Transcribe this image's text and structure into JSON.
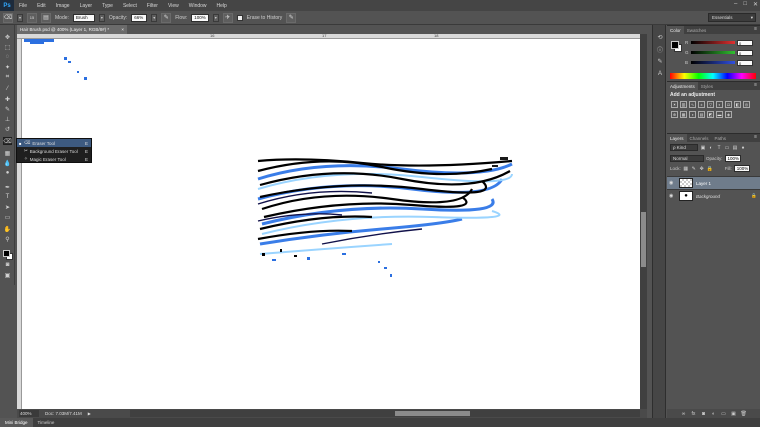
{
  "menubar": {
    "logo": "Ps",
    "items": [
      "File",
      "Edit",
      "Image",
      "Layer",
      "Type",
      "Select",
      "Filter",
      "View",
      "Window",
      "Help"
    ],
    "window_controls": [
      "–",
      "□",
      "✕"
    ]
  },
  "options": {
    "tool_icon": "eraser-icon",
    "brush_size": "15",
    "mode_label": "Mode:",
    "mode_value": "Brush",
    "opacity_label": "Opacity:",
    "opacity_value": "66%",
    "flow_label": "Flow:",
    "flow_value": "100%",
    "erase_history": "Erase to History",
    "workspace": "Essentials"
  },
  "document": {
    "tab_title": "Hair Brush.psd @ 400% (Layer 1, RGB/8#) *",
    "tab_close": "×",
    "ruler_numbers": [
      "16",
      "17",
      "18"
    ],
    "zoom": "400%",
    "doc_info": "Doc: 7.03M/7.41M"
  },
  "flyout": {
    "items": [
      {
        "label": "Eraser Tool",
        "key": "E",
        "selected": true
      },
      {
        "label": "Background Eraser Tool",
        "key": "E",
        "selected": false
      },
      {
        "label": "Magic Eraser Tool",
        "key": "E",
        "selected": false
      }
    ]
  },
  "bottom_tabs": [
    "Mini Bridge",
    "Timeline"
  ],
  "color_panel": {
    "tabs": [
      "Color",
      "Swatches"
    ],
    "channels": [
      {
        "label": "R",
        "value": "0",
        "color": "#e03030"
      },
      {
        "label": "G",
        "value": "0",
        "color": "#30c030"
      },
      {
        "label": "B",
        "value": "0",
        "color": "#3050e0"
      }
    ],
    "menu": "≡"
  },
  "adjustments_panel": {
    "tabs": [
      "Adjustments",
      "Styles"
    ],
    "title": "Add an adjustment",
    "menu": "≡"
  },
  "layers_panel": {
    "tabs": [
      "Layers",
      "Channels",
      "Paths"
    ],
    "kind": "ρ Kind",
    "blend_mode": "Normal",
    "opacity_label": "Opacity:",
    "opacity_value": "100%",
    "lock_label": "Lock:",
    "fill_label": "Fill:",
    "fill_value": "100%",
    "menu": "≡",
    "layers": [
      {
        "name": "Layer 1",
        "selected": true
      },
      {
        "name": "Background",
        "selected": false
      }
    ]
  },
  "colors": {
    "foreground": "#000000",
    "background": "#ffffff",
    "selection": "#3d5a80",
    "layer_selected": "#6f7c8b"
  }
}
